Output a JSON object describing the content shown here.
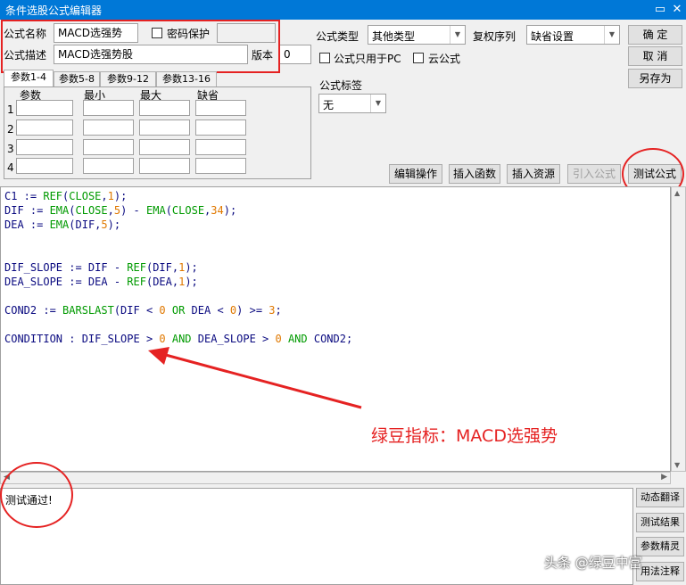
{
  "window": {
    "title": "条件选股公式编辑器",
    "minimize": "▭",
    "close": "✕"
  },
  "formula": {
    "name_label": "公式名称",
    "name_value": "MACD选强势",
    "password_label": "密码保护",
    "desc_label": "公式描述",
    "desc_value": "MACD选强势股",
    "version_label": "版本",
    "version_value": "0",
    "type_label": "公式类型",
    "type_value": "其他类型",
    "rights_label": "复权序列",
    "rights_value": "缺省设置",
    "pc_only_label": "公式只用于PC",
    "cloud_label": "云公式",
    "tag_label": "公式标签",
    "tag_value": "无"
  },
  "buttons": {
    "ok": "确  定",
    "cancel": "取  消",
    "save_as": "另存为",
    "edit_op": "编辑操作",
    "insert_func": "插入函数",
    "insert_res": "插入资源",
    "import": "引入公式",
    "test": "测试公式"
  },
  "tabs": [
    "参数1-4",
    "参数5-8",
    "参数9-12",
    "参数13-16"
  ],
  "params": {
    "headers": [
      "参数",
      "最小",
      "最大",
      "缺省"
    ],
    "rows": [
      "1",
      "2",
      "3",
      "4"
    ]
  },
  "code_lines": [
    [
      [
        "C1 := ",
        "o"
      ],
      [
        "REF",
        "k"
      ],
      [
        "(",
        "o"
      ],
      [
        "CLOSE",
        "k"
      ],
      [
        ",",
        "o"
      ],
      [
        "1",
        "n"
      ],
      [
        ");",
        "o"
      ]
    ],
    [
      [
        "DIF := ",
        "o"
      ],
      [
        "EMA",
        "k"
      ],
      [
        "(",
        "o"
      ],
      [
        "CLOSE",
        "k"
      ],
      [
        ",",
        "o"
      ],
      [
        "5",
        "n"
      ],
      [
        ") - ",
        "o"
      ],
      [
        "EMA",
        "k"
      ],
      [
        "(",
        "o"
      ],
      [
        "CLOSE",
        "k"
      ],
      [
        ",",
        "o"
      ],
      [
        "34",
        "n"
      ],
      [
        ");",
        "o"
      ]
    ],
    [
      [
        "DEA := ",
        "o"
      ],
      [
        "EMA",
        "k"
      ],
      [
        "(DIF,",
        "o"
      ],
      [
        "5",
        "n"
      ],
      [
        ");",
        "o"
      ]
    ],
    [],
    [],
    [
      [
        "DIF_SLOPE := DIF - ",
        "o"
      ],
      [
        "REF",
        "k"
      ],
      [
        "(DIF,",
        "o"
      ],
      [
        "1",
        "n"
      ],
      [
        ");",
        "o"
      ]
    ],
    [
      [
        "DEA_SLOPE := DEA - ",
        "o"
      ],
      [
        "REF",
        "k"
      ],
      [
        "(DEA,",
        "o"
      ],
      [
        "1",
        "n"
      ],
      [
        ");",
        "o"
      ]
    ],
    [],
    [
      [
        "COND2 := ",
        "o"
      ],
      [
        "BARSLAST",
        "k"
      ],
      [
        "(DIF < ",
        "o"
      ],
      [
        "0",
        "n"
      ],
      [
        " ",
        "o"
      ],
      [
        "OR",
        "k"
      ],
      [
        " DEA < ",
        "o"
      ],
      [
        "0",
        "n"
      ],
      [
        ") >= ",
        "o"
      ],
      [
        "3",
        "n"
      ],
      [
        ";",
        "o"
      ]
    ],
    [],
    [
      [
        "CONDITION : DIF_SLOPE > ",
        "o"
      ],
      [
        "0",
        "n"
      ],
      [
        " ",
        "o"
      ],
      [
        "AND",
        "k"
      ],
      [
        " DEA_SLOPE > ",
        "o"
      ],
      [
        "0",
        "n"
      ],
      [
        " ",
        "o"
      ],
      [
        "AND",
        "k"
      ],
      [
        " COND2;",
        "o"
      ]
    ]
  ],
  "annotation": "绿豆指标：MACD选强势",
  "result_text": "测试通过!",
  "right_buttons": [
    "动态翻译",
    "测试结果",
    "参数精灵",
    "用法注释"
  ],
  "watermark": "头条 @绿豆中富",
  "colors": {
    "titlebar": "#0078d7",
    "highlight": "#e52222",
    "keyword": "#009a00",
    "number": "#e07800"
  }
}
